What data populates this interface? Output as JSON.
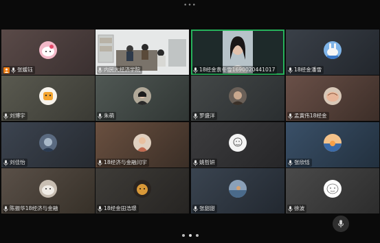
{
  "top_menu": {
    "icon": "more-dots-icon",
    "label": "•••"
  },
  "accent": "#27b35c",
  "host_color": "#f07d12",
  "participants": [
    {
      "name": "张媛钰",
      "bg": [
        "#5a4a48",
        "#3a3030"
      ],
      "avatar": "hello-kitty",
      "host": true
    },
    {
      "name": "内民大经济学院",
      "bg": [
        "#d9dcdc",
        "#8e8a84"
      ],
      "avatar": "classroom-video",
      "host": false
    },
    {
      "name": "18经金袁冬雪1690020441017",
      "bg": [
        "#a9b6bf",
        "#d6d9dc"
      ],
      "avatar": "camera-video",
      "host": false,
      "active": true
    },
    {
      "name": "18经金潘雪",
      "bg": [
        "#3a4048",
        "#22262c"
      ],
      "avatar": "rabbit",
      "host": false
    },
    {
      "name": "刘博宇",
      "bg": [
        "#5a5a50",
        "#3a3a34"
      ],
      "avatar": "orange-sticker",
      "host": false
    },
    {
      "name": "朱萌",
      "bg": [
        "#505854",
        "#303634"
      ],
      "avatar": "girl-photo",
      "host": false
    },
    {
      "name": "罗盛洋",
      "bg": [
        "#444848",
        "#2a2e30"
      ],
      "avatar": "dark-portrait",
      "host": false
    },
    {
      "name": "孟寅伟18经金",
      "bg": [
        "#6a5048",
        "#3c2e28"
      ],
      "avatar": "peach-blob",
      "host": false
    },
    {
      "name": "刘佳怡",
      "bg": [
        "#3c4450",
        "#262a30"
      ],
      "avatar": "blue-portrait",
      "host": false
    },
    {
      "name": "18经济与金融闫宇",
      "bg": [
        "#6a5040",
        "#3a2e26"
      ],
      "avatar": "girl-pose",
      "host": false
    },
    {
      "name": "姚哲妍",
      "bg": [
        "#3c3c3e",
        "#262628"
      ],
      "avatar": "sketch-face",
      "host": false
    },
    {
      "name": "张欣恬",
      "bg": [
        "#3a5068",
        "#22303e"
      ],
      "avatar": "sunset",
      "host": false
    },
    {
      "name": "陈振华18经济与金融",
      "bg": [
        "#5a5048",
        "#363028"
      ],
      "avatar": "seal",
      "host": false
    },
    {
      "name": "18经金田浩璟",
      "bg": [
        "#3e3c38",
        "#262422"
      ],
      "avatar": "cat-dark",
      "host": false
    },
    {
      "name": "张甜甜",
      "bg": [
        "#3a4450",
        "#222830"
      ],
      "avatar": "seascape",
      "host": false
    },
    {
      "name": "徐波",
      "bg": [
        "#4a4a4a",
        "#2c2c2c"
      ],
      "avatar": "cartoon-doodle",
      "host": false
    }
  ],
  "pager": {
    "pages": 3,
    "current": 2
  }
}
